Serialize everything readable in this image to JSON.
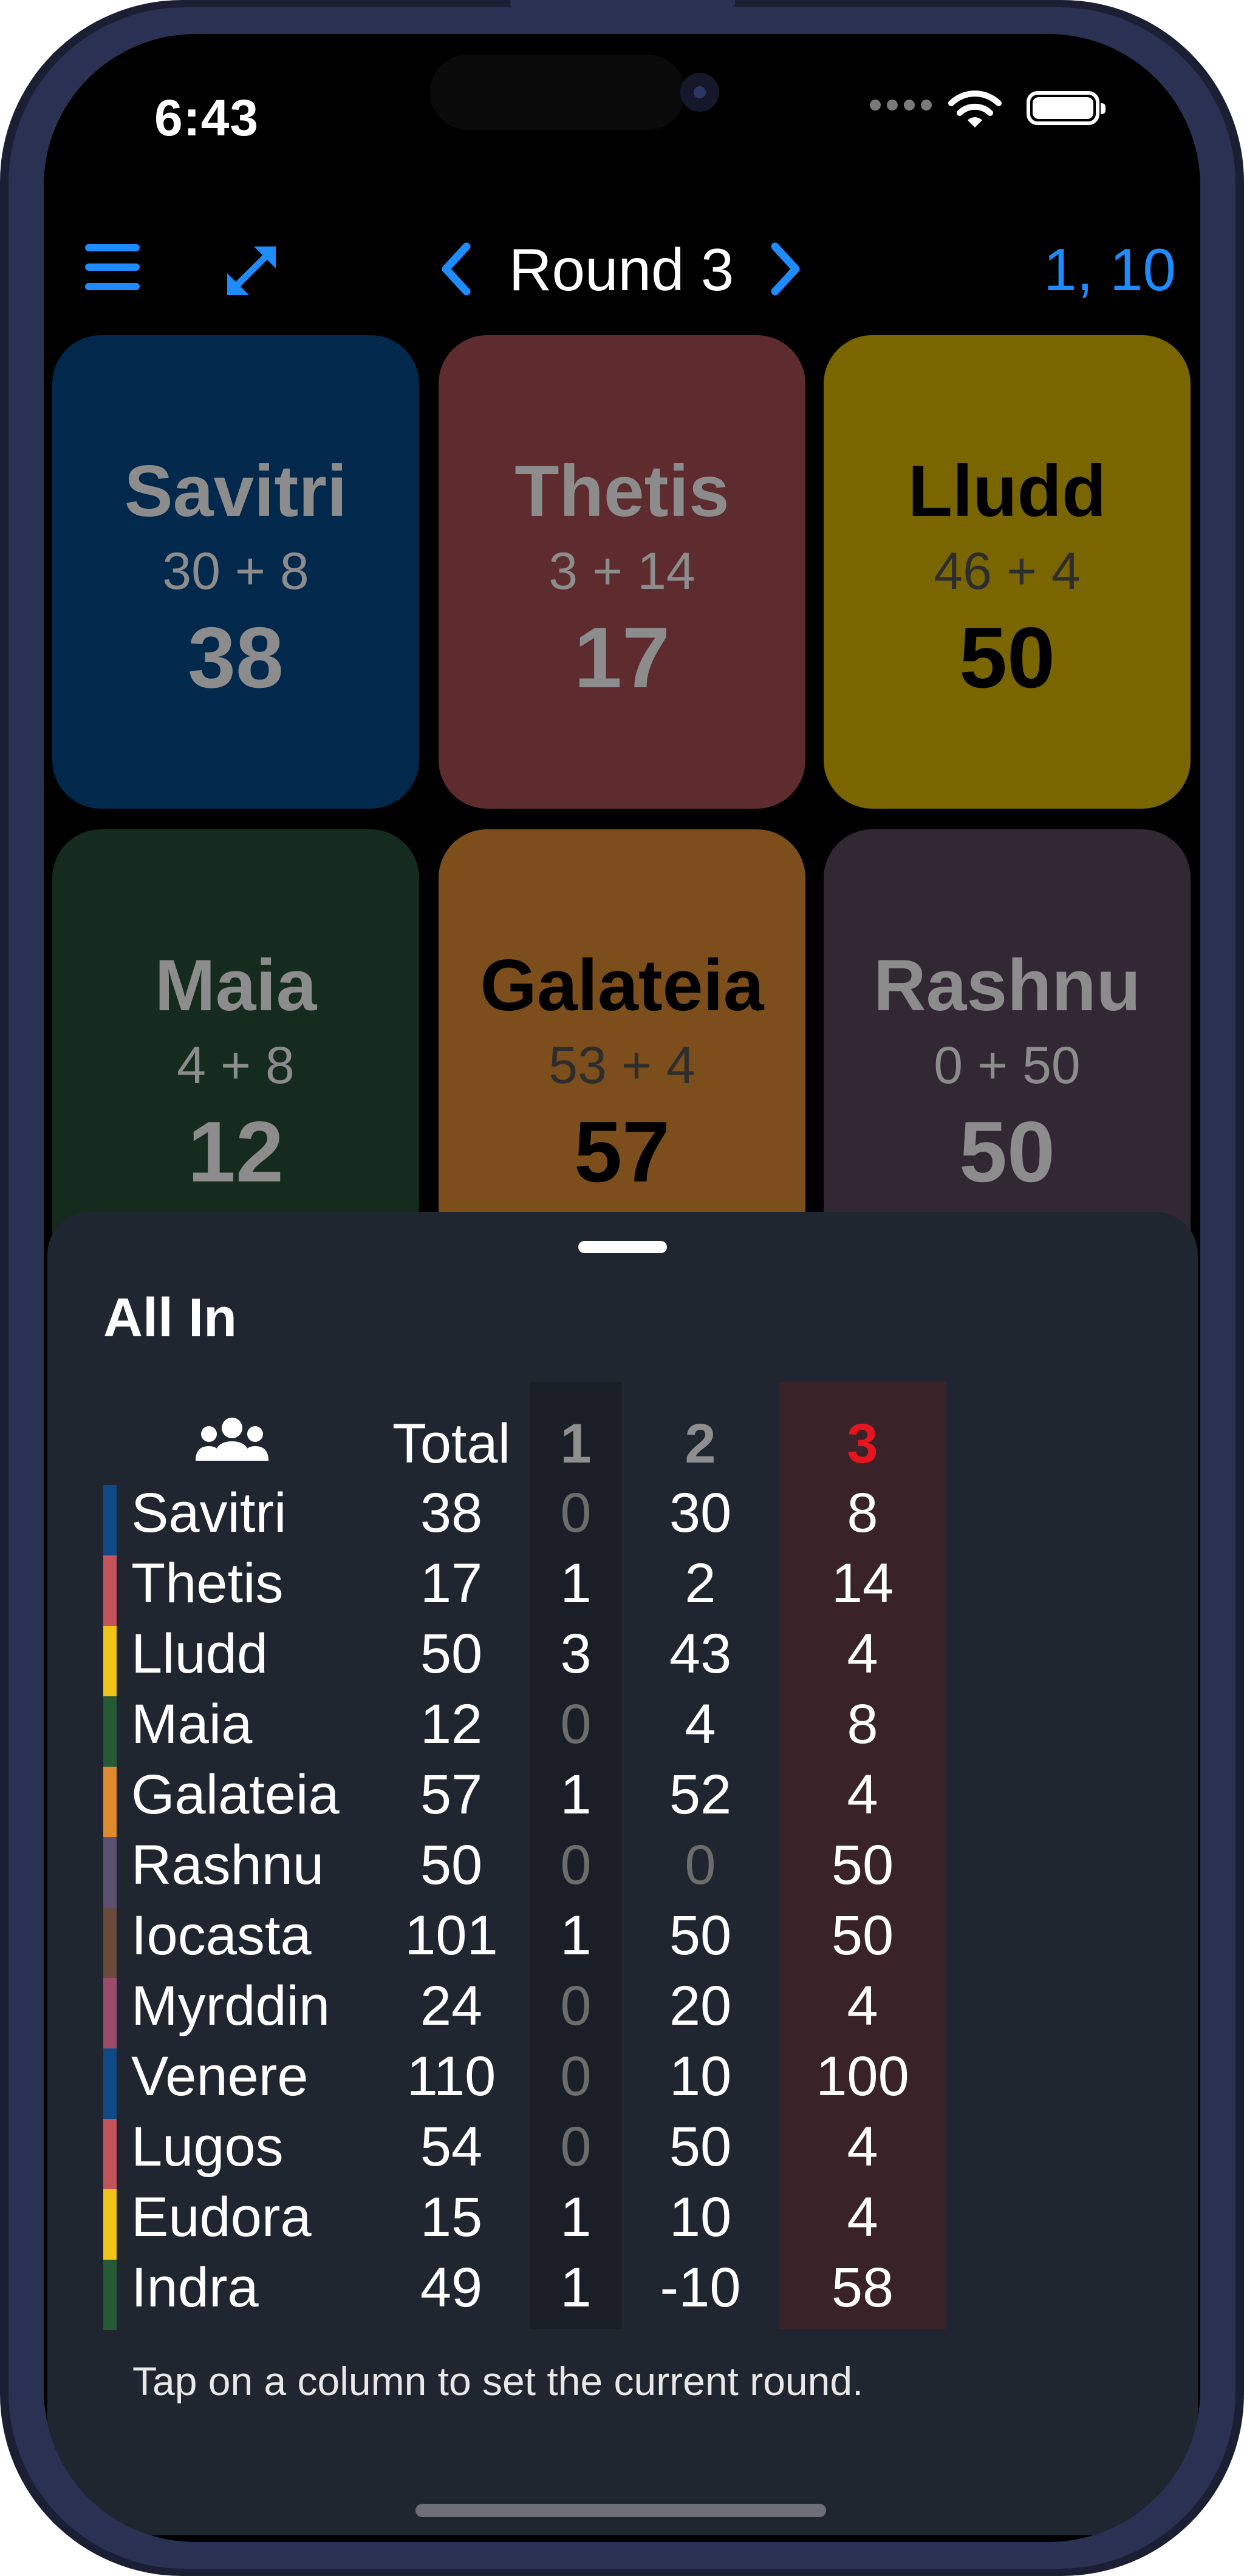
{
  "status_bar": {
    "time": "6:43"
  },
  "nav": {
    "menu_icon": "hamburger-icon",
    "expand_icon": "expand-arrows-icon",
    "title": "Round 3",
    "right_label": "1, 10",
    "accent": "#1e8bff"
  },
  "cards": [
    {
      "name": "Savitri",
      "calc": "30 + 8",
      "total": "38",
      "color": "#02284b",
      "text": "dark"
    },
    {
      "name": "Thetis",
      "calc": "3 + 14",
      "total": "17",
      "color": "#5e2b2e",
      "text": "dark"
    },
    {
      "name": "Lludd",
      "calc": "46 + 4",
      "total": "50",
      "color": "#7a6600",
      "text": "light"
    },
    {
      "name": "Maia",
      "calc": "4 + 8",
      "total": "12",
      "color": "#152b1d",
      "text": "dark"
    },
    {
      "name": "Galateia",
      "calc": "53 + 4",
      "total": "57",
      "color": "#7c4e1b",
      "text": "light"
    },
    {
      "name": "Rashnu",
      "calc": "0 + 50",
      "total": "50",
      "color": "#312833",
      "text": "dark"
    }
  ],
  "sheet": {
    "title": "All In",
    "players_icon": "group-icon",
    "headers": {
      "total": "Total",
      "r1": "1",
      "r2": "2",
      "r3": "3"
    },
    "current_round_color": "#e6141e",
    "rows": [
      {
        "name": "Savitri",
        "total": "38",
        "r1": "0",
        "r2": "30",
        "r3": "8",
        "color": "#0f4a86"
      },
      {
        "name": "Thetis",
        "total": "17",
        "r1": "1",
        "r2": "2",
        "r3": "14",
        "color": "#c4535c"
      },
      {
        "name": "Lludd",
        "total": "50",
        "r1": "3",
        "r2": "43",
        "r3": "4",
        "color": "#f0c419"
      },
      {
        "name": "Maia",
        "total": "12",
        "r1": "0",
        "r2": "4",
        "r3": "8",
        "color": "#265a35"
      },
      {
        "name": "Galateia",
        "total": "57",
        "r1": "1",
        "r2": "52",
        "r3": "4",
        "color": "#df8a2e"
      },
      {
        "name": "Rashnu",
        "total": "50",
        "r1": "0",
        "r2": "0",
        "r3": "50",
        "color": "#5b5070"
      },
      {
        "name": "Iocasta",
        "total": "101",
        "r1": "1",
        "r2": "50",
        "r3": "50",
        "color": "#6a4a3a"
      },
      {
        "name": "Myrddin",
        "total": "24",
        "r1": "0",
        "r2": "20",
        "r3": "4",
        "color": "#9a4c6a"
      },
      {
        "name": "Venere",
        "total": "110",
        "r1": "0",
        "r2": "10",
        "r3": "100",
        "color": "#0f4a86"
      },
      {
        "name": "Lugos",
        "total": "54",
        "r1": "0",
        "r2": "50",
        "r3": "4",
        "color": "#c4535c"
      },
      {
        "name": "Eudora",
        "total": "15",
        "r1": "1",
        "r2": "10",
        "r3": "4",
        "color": "#f0c419"
      },
      {
        "name": "Indra",
        "total": "49",
        "r1": "1",
        "r2": "-10",
        "r3": "58",
        "color": "#265a35"
      }
    ],
    "hint": "Tap on a column to set the current round."
  }
}
